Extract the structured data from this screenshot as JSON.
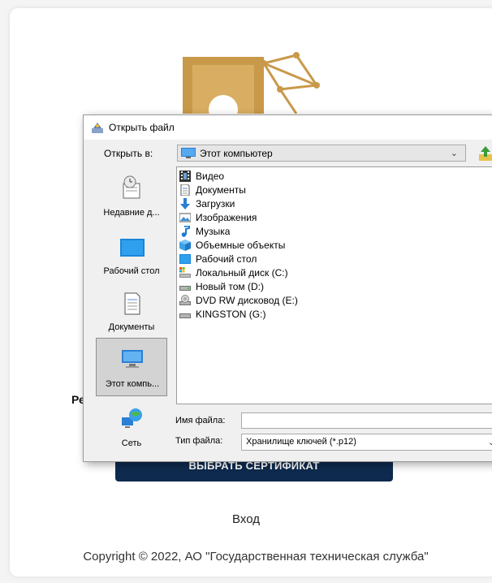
{
  "page": {
    "partial_label": "Ре",
    "choose_button": "ВЫБРАТЬ СЕРТИФИКАТ",
    "login_link": "Вход",
    "copyright": "Copyright © 2022, АО \"Государственная техническая служба\""
  },
  "dialog": {
    "title": "Открыть файл",
    "look_in_label": "Открыть в:",
    "look_in_value": "Этот компьютер",
    "places": [
      {
        "label": "Недавние д..."
      },
      {
        "label": "Рабочий стол"
      },
      {
        "label": "Документы"
      },
      {
        "label": "Этот компь..."
      },
      {
        "label": "Сеть"
      }
    ],
    "files": [
      {
        "name": "Видео",
        "icon": "video-folder-icon"
      },
      {
        "name": "Документы",
        "icon": "documents-folder-icon"
      },
      {
        "name": "Загрузки",
        "icon": "downloads-arrow-icon"
      },
      {
        "name": "Изображения",
        "icon": "pictures-folder-icon"
      },
      {
        "name": "Музыка",
        "icon": "music-note-icon"
      },
      {
        "name": "Объемные объекты",
        "icon": "3d-objects-icon"
      },
      {
        "name": "Рабочий стол",
        "icon": "desktop-icon"
      },
      {
        "name": "Локальный диск (C:)",
        "icon": "system-drive-icon"
      },
      {
        "name": "Новый том (D:)",
        "icon": "drive-icon"
      },
      {
        "name": "DVD RW дисковод (E:)",
        "icon": "dvd-drive-icon"
      },
      {
        "name": "KINGSTON (G:)",
        "icon": "usb-drive-icon"
      }
    ],
    "file_name_label": "Имя файла:",
    "file_name_value": "",
    "file_type_label": "Тип файла:",
    "file_type_value": "Хранилище ключей (*.p12)"
  },
  "colors": {
    "button_bg": "#0e2a4e",
    "logo_gold": "#c9994a",
    "selection": "#d3d3d3"
  }
}
